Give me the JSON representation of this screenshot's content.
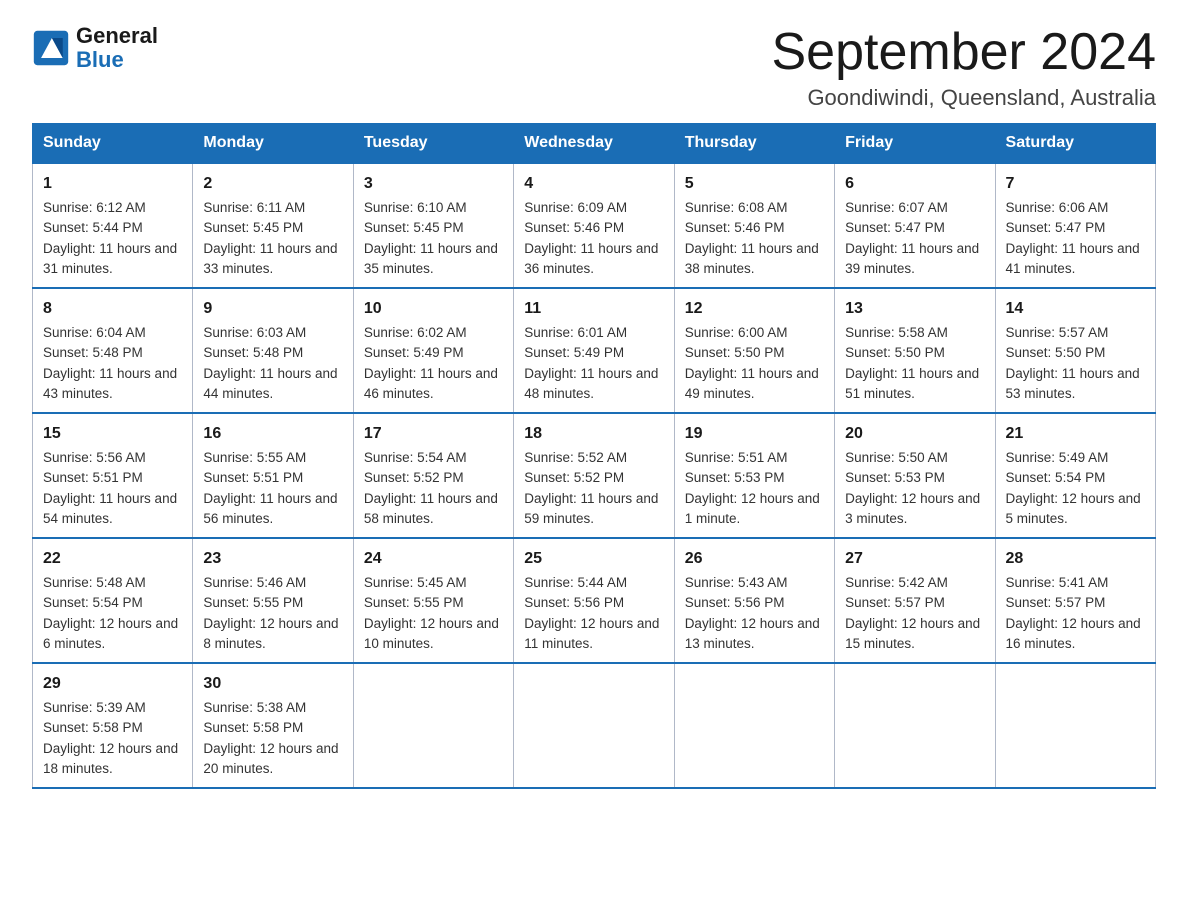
{
  "header": {
    "logo_general": "General",
    "logo_blue": "Blue",
    "title": "September 2024",
    "subtitle": "Goondiwindi, Queensland, Australia"
  },
  "days_header": [
    "Sunday",
    "Monday",
    "Tuesday",
    "Wednesday",
    "Thursday",
    "Friday",
    "Saturday"
  ],
  "weeks": [
    [
      {
        "date": "1",
        "sunrise": "6:12 AM",
        "sunset": "5:44 PM",
        "daylight": "11 hours and 31 minutes."
      },
      {
        "date": "2",
        "sunrise": "6:11 AM",
        "sunset": "5:45 PM",
        "daylight": "11 hours and 33 minutes."
      },
      {
        "date": "3",
        "sunrise": "6:10 AM",
        "sunset": "5:45 PM",
        "daylight": "11 hours and 35 minutes."
      },
      {
        "date": "4",
        "sunrise": "6:09 AM",
        "sunset": "5:46 PM",
        "daylight": "11 hours and 36 minutes."
      },
      {
        "date": "5",
        "sunrise": "6:08 AM",
        "sunset": "5:46 PM",
        "daylight": "11 hours and 38 minutes."
      },
      {
        "date": "6",
        "sunrise": "6:07 AM",
        "sunset": "5:47 PM",
        "daylight": "11 hours and 39 minutes."
      },
      {
        "date": "7",
        "sunrise": "6:06 AM",
        "sunset": "5:47 PM",
        "daylight": "11 hours and 41 minutes."
      }
    ],
    [
      {
        "date": "8",
        "sunrise": "6:04 AM",
        "sunset": "5:48 PM",
        "daylight": "11 hours and 43 minutes."
      },
      {
        "date": "9",
        "sunrise": "6:03 AM",
        "sunset": "5:48 PM",
        "daylight": "11 hours and 44 minutes."
      },
      {
        "date": "10",
        "sunrise": "6:02 AM",
        "sunset": "5:49 PM",
        "daylight": "11 hours and 46 minutes."
      },
      {
        "date": "11",
        "sunrise": "6:01 AM",
        "sunset": "5:49 PM",
        "daylight": "11 hours and 48 minutes."
      },
      {
        "date": "12",
        "sunrise": "6:00 AM",
        "sunset": "5:50 PM",
        "daylight": "11 hours and 49 minutes."
      },
      {
        "date": "13",
        "sunrise": "5:58 AM",
        "sunset": "5:50 PM",
        "daylight": "11 hours and 51 minutes."
      },
      {
        "date": "14",
        "sunrise": "5:57 AM",
        "sunset": "5:50 PM",
        "daylight": "11 hours and 53 minutes."
      }
    ],
    [
      {
        "date": "15",
        "sunrise": "5:56 AM",
        "sunset": "5:51 PM",
        "daylight": "11 hours and 54 minutes."
      },
      {
        "date": "16",
        "sunrise": "5:55 AM",
        "sunset": "5:51 PM",
        "daylight": "11 hours and 56 minutes."
      },
      {
        "date": "17",
        "sunrise": "5:54 AM",
        "sunset": "5:52 PM",
        "daylight": "11 hours and 58 minutes."
      },
      {
        "date": "18",
        "sunrise": "5:52 AM",
        "sunset": "5:52 PM",
        "daylight": "11 hours and 59 minutes."
      },
      {
        "date": "19",
        "sunrise": "5:51 AM",
        "sunset": "5:53 PM",
        "daylight": "12 hours and 1 minute."
      },
      {
        "date": "20",
        "sunrise": "5:50 AM",
        "sunset": "5:53 PM",
        "daylight": "12 hours and 3 minutes."
      },
      {
        "date": "21",
        "sunrise": "5:49 AM",
        "sunset": "5:54 PM",
        "daylight": "12 hours and 5 minutes."
      }
    ],
    [
      {
        "date": "22",
        "sunrise": "5:48 AM",
        "sunset": "5:54 PM",
        "daylight": "12 hours and 6 minutes."
      },
      {
        "date": "23",
        "sunrise": "5:46 AM",
        "sunset": "5:55 PM",
        "daylight": "12 hours and 8 minutes."
      },
      {
        "date": "24",
        "sunrise": "5:45 AM",
        "sunset": "5:55 PM",
        "daylight": "12 hours and 10 minutes."
      },
      {
        "date": "25",
        "sunrise": "5:44 AM",
        "sunset": "5:56 PM",
        "daylight": "12 hours and 11 minutes."
      },
      {
        "date": "26",
        "sunrise": "5:43 AM",
        "sunset": "5:56 PM",
        "daylight": "12 hours and 13 minutes."
      },
      {
        "date": "27",
        "sunrise": "5:42 AM",
        "sunset": "5:57 PM",
        "daylight": "12 hours and 15 minutes."
      },
      {
        "date": "28",
        "sunrise": "5:41 AM",
        "sunset": "5:57 PM",
        "daylight": "12 hours and 16 minutes."
      }
    ],
    [
      {
        "date": "29",
        "sunrise": "5:39 AM",
        "sunset": "5:58 PM",
        "daylight": "12 hours and 18 minutes."
      },
      {
        "date": "30",
        "sunrise": "5:38 AM",
        "sunset": "5:58 PM",
        "daylight": "12 hours and 20 minutes."
      },
      null,
      null,
      null,
      null,
      null
    ]
  ],
  "labels": {
    "sunrise": "Sunrise:",
    "sunset": "Sunset:",
    "daylight": "Daylight:"
  }
}
